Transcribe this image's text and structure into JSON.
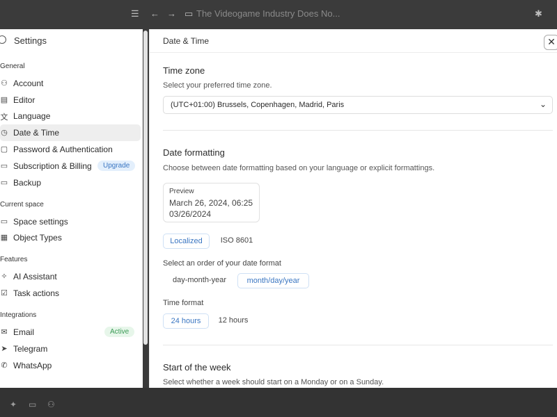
{
  "topbar": {
    "title": "The Videogame Industry Does No...",
    "list_glyph": "☰",
    "back_glyph": "←",
    "forward_glyph": "→",
    "page_glyph": "▭",
    "pin_glyph": "✱"
  },
  "bottombar": {
    "glyph1": "✦",
    "glyph2": "▭",
    "glyph3": "⚇"
  },
  "sidebar": {
    "title": "Settings",
    "sections": {
      "general": "General",
      "current_space": "Current space",
      "features": "Features",
      "integrations": "Integrations"
    },
    "items": {
      "account": {
        "label": "Account",
        "icon": "user-icon",
        "glyph": "⚇"
      },
      "editor": {
        "label": "Editor",
        "icon": "editor-icon",
        "glyph": "▤"
      },
      "language": {
        "label": "Language",
        "icon": "language-icon",
        "glyph": "文"
      },
      "datetime": {
        "label": "Date & Time",
        "icon": "clock-icon",
        "glyph": "◷"
      },
      "password": {
        "label": "Password & Authentication",
        "icon": "lock-icon",
        "glyph": "▢"
      },
      "subscription": {
        "label": "Subscription & Billing",
        "icon": "card-icon",
        "glyph": "▭",
        "badge": "Upgrade"
      },
      "backup": {
        "label": "Backup",
        "icon": "backup-icon",
        "glyph": "▭"
      },
      "space_settings": {
        "label": "Space settings",
        "icon": "monitor-icon",
        "glyph": "▭"
      },
      "object_types": {
        "label": "Object Types",
        "icon": "table-icon",
        "glyph": "▦"
      },
      "ai": {
        "label": "AI Assistant",
        "icon": "sparkle-icon",
        "glyph": "✧"
      },
      "tasks": {
        "label": "Task actions",
        "icon": "checkbox-icon",
        "glyph": "☑"
      },
      "email": {
        "label": "Email",
        "icon": "mail-icon",
        "glyph": "✉",
        "badge": "Active"
      },
      "telegram": {
        "label": "Telegram",
        "icon": "telegram-icon",
        "glyph": "➤"
      },
      "whatsapp": {
        "label": "WhatsApp",
        "icon": "whatsapp-icon",
        "glyph": "✆"
      }
    }
  },
  "main": {
    "title": "Date & Time",
    "close_glyph": "✕",
    "timezone": {
      "heading": "Time zone",
      "desc": "Select your preferred time zone.",
      "value": "(UTC+01:00) Brussels, Copenhagen, Madrid, Paris",
      "chevron": "⌄"
    },
    "formatting": {
      "heading": "Date formatting",
      "desc": "Choose between date formatting based on your language or explicit formattings.",
      "preview_label": "Preview",
      "preview_line1": "March 26, 2024, 06:25",
      "preview_line2": "03/26/2024",
      "mode_localized": "Localized",
      "mode_iso": "ISO 8601",
      "order_label": "Select an order of your date format",
      "order_dmy": "day-month-year",
      "order_mdy": "month/day/year",
      "time_label": "Time format",
      "time_24": "24 hours",
      "time_12": "12 hours"
    },
    "week": {
      "heading": "Start of the week",
      "desc": "Select whether a week should start on a Monday or on a Sunday."
    }
  },
  "colors": {
    "accent": "#3a76c2",
    "active_green": "#3a9a55",
    "selected_bg": "#eeeeee"
  }
}
